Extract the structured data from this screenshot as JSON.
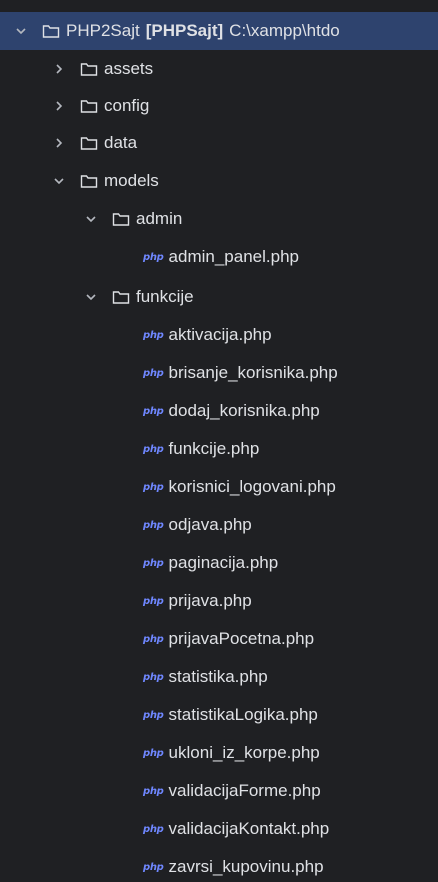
{
  "project": {
    "name": "PHP2Sajt",
    "module": "[PHPSajt]",
    "path": "C:\\xampp\\htdo"
  },
  "folders": {
    "assets": "assets",
    "config": "config",
    "data": "data",
    "models": "models",
    "admin": "admin",
    "funkcije": "funkcije"
  },
  "php_icon_text": "php",
  "admin_files": [
    "admin_panel.php"
  ],
  "funkcije_files": [
    "aktivacija.php",
    "brisanje_korisnika.php",
    "dodaj_korisnika.php",
    "funkcije.php",
    "korisnici_logovani.php",
    "odjava.php",
    "paginacija.php",
    "prijava.php",
    "prijavaPocetna.php",
    "statistika.php",
    "statistikaLogika.php",
    "ukloni_iz_korpe.php",
    "validacijaForme.php",
    "validacijaKontakt.php",
    "zavrsi_kupovinu.php"
  ],
  "colors": {
    "background": "#1f2023",
    "selection": "#2e436e",
    "text": "#dfe1e5",
    "php_icon": "#6f87ff"
  }
}
